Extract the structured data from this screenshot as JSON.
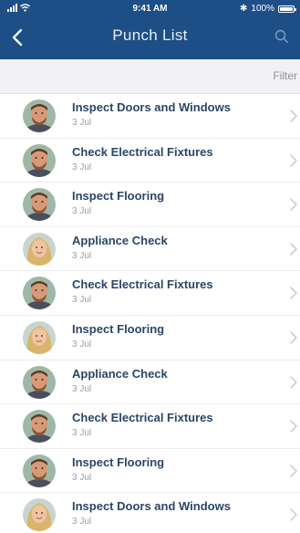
{
  "status_bar": {
    "time": "9:41 AM",
    "bluetooth": "✱",
    "battery": "100%"
  },
  "nav": {
    "title": "Punch List",
    "back_icon": "chevron-left-icon",
    "search_icon": "search-icon"
  },
  "filter": {
    "label": "Filter"
  },
  "items": [
    {
      "title": "Inspect Doors and Windows",
      "date": "3 Jul",
      "avatar": "man"
    },
    {
      "title": "Check Electrical Fixtures",
      "date": "3 Jul",
      "avatar": "man"
    },
    {
      "title": "Inspect Flooring",
      "date": "3 Jul",
      "avatar": "man"
    },
    {
      "title": "Appliance Check",
      "date": "3 Jul",
      "avatar": "woman"
    },
    {
      "title": "Check Electrical Fixtures",
      "date": "3 Jul",
      "avatar": "man"
    },
    {
      "title": "Inspect Flooring",
      "date": "3 Jul",
      "avatar": "woman"
    },
    {
      "title": "Appliance Check",
      "date": "3 Jul",
      "avatar": "man"
    },
    {
      "title": "Check Electrical Fixtures",
      "date": "3 Jul",
      "avatar": "man"
    },
    {
      "title": "Inspect Flooring",
      "date": "3 Jul",
      "avatar": "man"
    },
    {
      "title": "Inspect Doors and Windows",
      "date": "3 Jul",
      "avatar": "woman"
    }
  ],
  "colors": {
    "header": "#1d4f86",
    "title_text": "#2b4667",
    "date_text": "#9a9ea4",
    "filter_bg": "#f1f1f3"
  }
}
